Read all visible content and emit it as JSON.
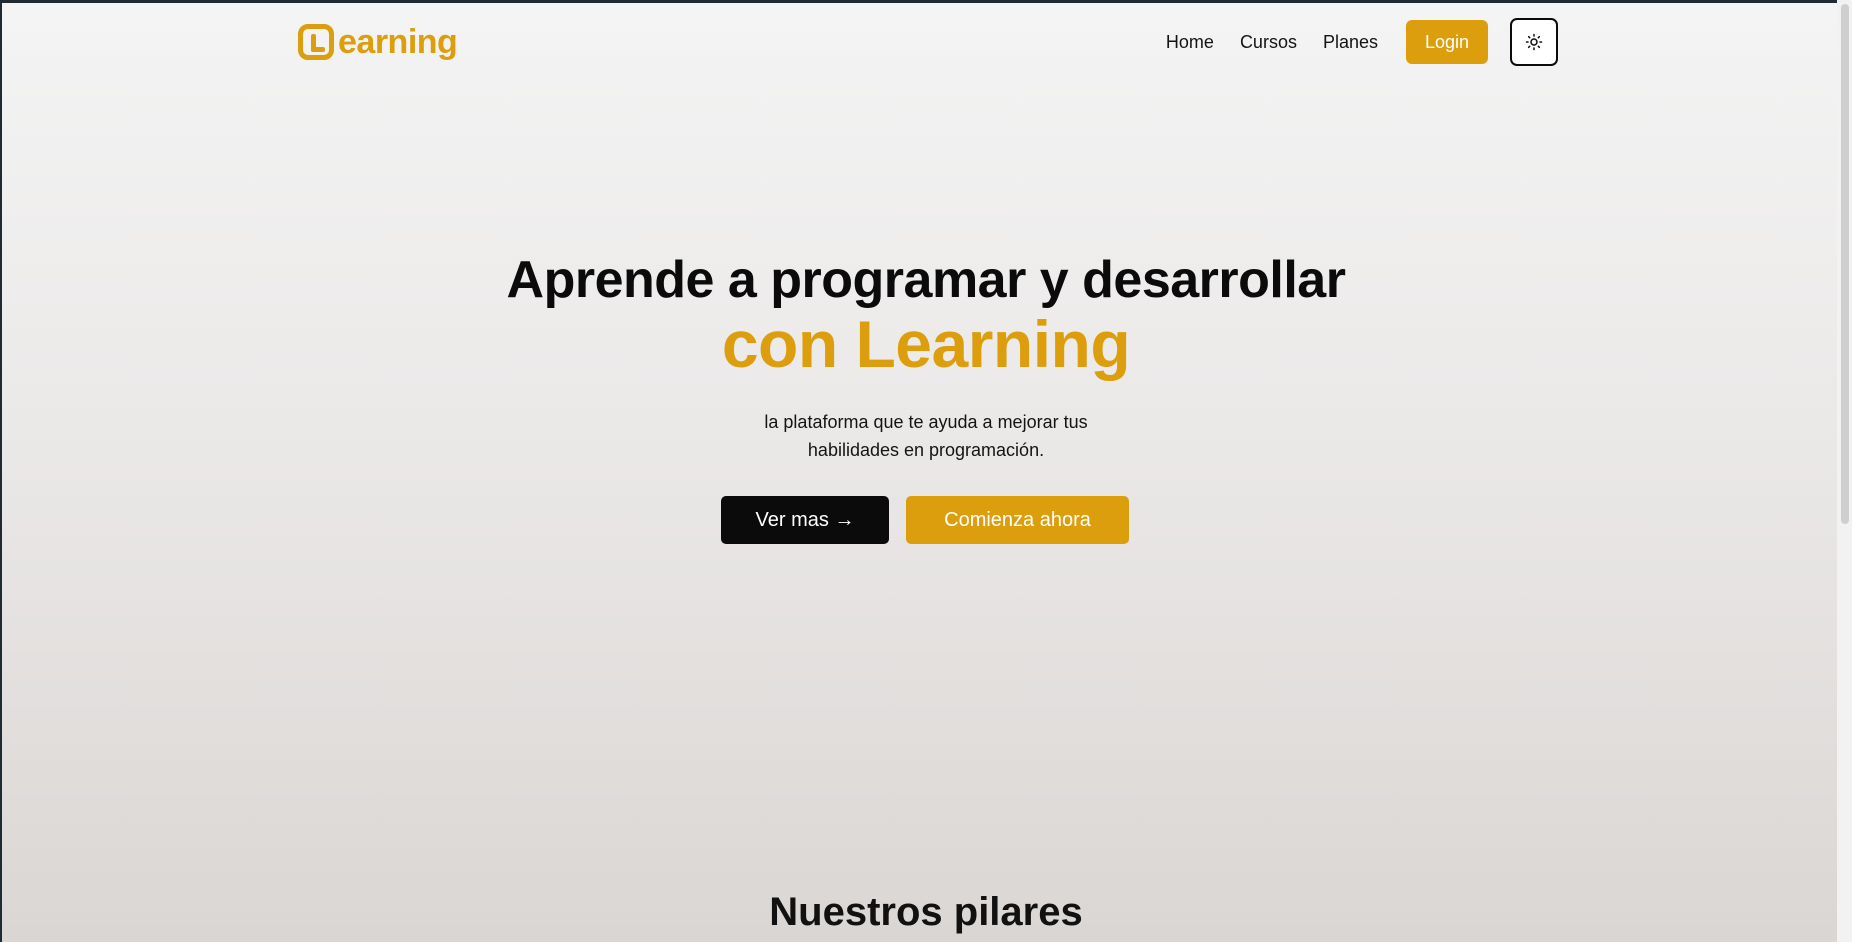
{
  "brand": {
    "name": "earning",
    "accent_color": "#dc9e0d"
  },
  "nav": {
    "links": [
      "Home",
      "Cursos",
      "Planes"
    ],
    "login_label": "Login",
    "theme_toggle_icon": "sun-icon"
  },
  "hero": {
    "title": "Aprende a programar y desarrollar",
    "subtitle": "con Learning",
    "description": "la plataforma que te ayuda a mejorar tus habilidades en programación.",
    "primary_button": "Ver mas →",
    "secondary_button": "Comienza ahora"
  },
  "section": {
    "heading": "Nuestros pilares"
  }
}
